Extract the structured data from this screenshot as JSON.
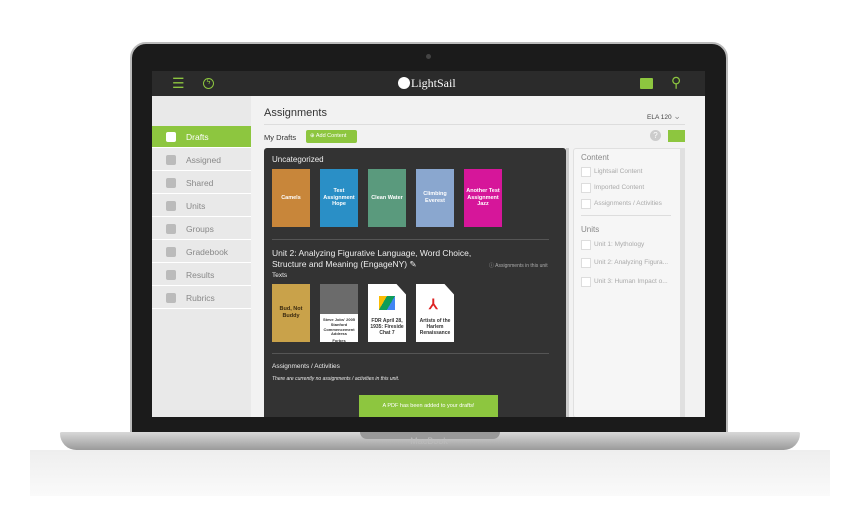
{
  "device": {
    "brand": "MacBook"
  },
  "topbar": {
    "logo": "LightSail",
    "menu_icon": "hamburger-icon",
    "bolt_icon": "lightning-icon",
    "library_icon": "book-icon",
    "search_icon": "search-icon"
  },
  "sidebar": {
    "items": [
      {
        "label": "Drafts",
        "active": true
      },
      {
        "label": "Assigned"
      },
      {
        "label": "Shared"
      },
      {
        "label": "Units"
      },
      {
        "label": "Groups"
      },
      {
        "label": "Gradebook"
      },
      {
        "label": "Results"
      },
      {
        "label": "Rubrics"
      }
    ]
  },
  "header": {
    "title": "Assignments",
    "class_selector": "ELA 120"
  },
  "drafts": {
    "label": "My Drafts",
    "add_button": "Add Content"
  },
  "uncategorized": {
    "title": "Uncategorized",
    "items": [
      {
        "title": "Camels",
        "color": "#c8863a"
      },
      {
        "title": "Test Assignment Hope",
        "color": "#2a8fc6"
      },
      {
        "title": "Clean Water",
        "color": "#5a9a7d"
      },
      {
        "title": "Climbing Everest",
        "color": "#8aa7cf"
      },
      {
        "title": "Another Test Assignment Jazz",
        "color": "#d6169a"
      }
    ]
  },
  "unit": {
    "title": "Unit 2: Analyzing Figurative Language, Word Choice, Structure and Meaning (EngageNY)",
    "assignments_note": "Assignments in this unit",
    "texts_label": "Texts",
    "texts": [
      {
        "title": "Bud, Not Buddy"
      },
      {
        "title": "Steve Jobs' 2005 Stanford Commencement Address",
        "sub": "Forbes"
      },
      {
        "title": "FDR April 28, 1935: Fireside Chat 7"
      },
      {
        "title": "Artists of the Harlem Renaissance"
      }
    ],
    "activities_label": "Assignments / Activities",
    "activities_empty": "There are currently no assignments / activities in this unit."
  },
  "toast": "A PDF has been added to your drafts!",
  "filters": {
    "content_title": "Content",
    "content": [
      "Lightsail Content",
      "Imported Content",
      "Assignments / Activities"
    ],
    "units_title": "Units",
    "units": [
      "Unit 1: Mythology",
      "Unit 2: Analyzing Figura...",
      "Unit 3: Human Impact o..."
    ]
  },
  "colors": {
    "accent": "#8dc63f",
    "topbar": "#2b2b2b",
    "panel": "#333333"
  }
}
